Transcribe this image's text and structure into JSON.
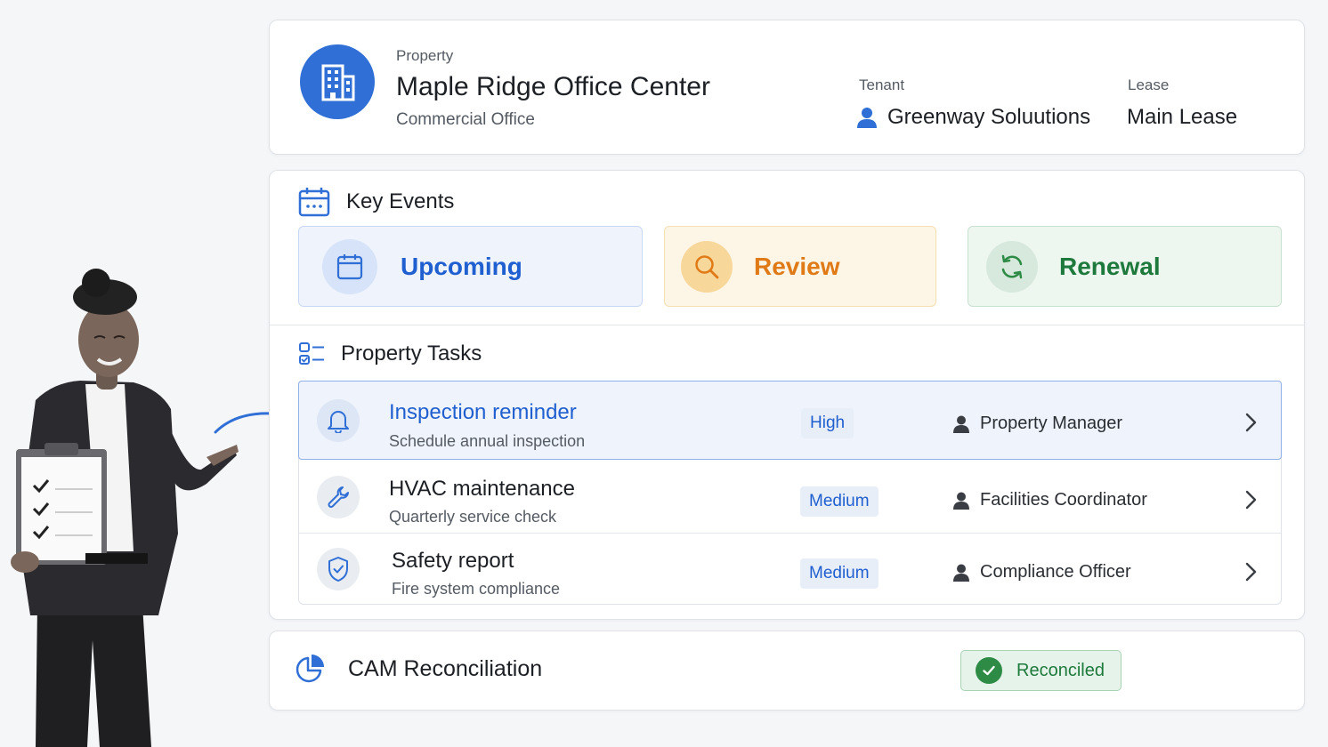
{
  "header": {
    "property_label": "Property",
    "property_name": "Maple Ridge Office Center",
    "property_type": "Commercial Office",
    "tenant_label": "Tenant",
    "tenant_name": "Greenway Soluutions",
    "lease_label": "Lease",
    "lease_name": "Main Lease"
  },
  "key_events": {
    "title": "Key Events",
    "items": [
      {
        "label": "Upcoming",
        "icon": "calendar-icon",
        "color": "#1f5fcf"
      },
      {
        "label": "Review",
        "icon": "search-icon",
        "color": "#e07a16"
      },
      {
        "label": "Renewal",
        "icon": "refresh-icon",
        "color": "#1e7a3c"
      }
    ]
  },
  "property_tasks": {
    "title": "Property Tasks",
    "items": [
      {
        "name": "Inspection reminder",
        "subtitle": "Schedule annual inspection",
        "priority": "High",
        "assignee": "Property Manager",
        "icon": "bell-icon"
      },
      {
        "name": "HVAC maintenance",
        "subtitle": "Quarterly service check",
        "priority": "Medium",
        "assignee": "Facilities Coordinator",
        "icon": "wrench-icon"
      },
      {
        "name": "Safety report",
        "subtitle": "Fire system compliance",
        "priority": "Medium",
        "assignee": "Compliance Officer",
        "icon": "shield-check-icon"
      }
    ]
  },
  "cam": {
    "title": "CAM Reconciliation",
    "status": "Reconciled",
    "icon": "pie-chart-icon"
  },
  "colors": {
    "accent": "#2f6fd6",
    "success": "#2e8b45",
    "warning": "#e07a16"
  }
}
